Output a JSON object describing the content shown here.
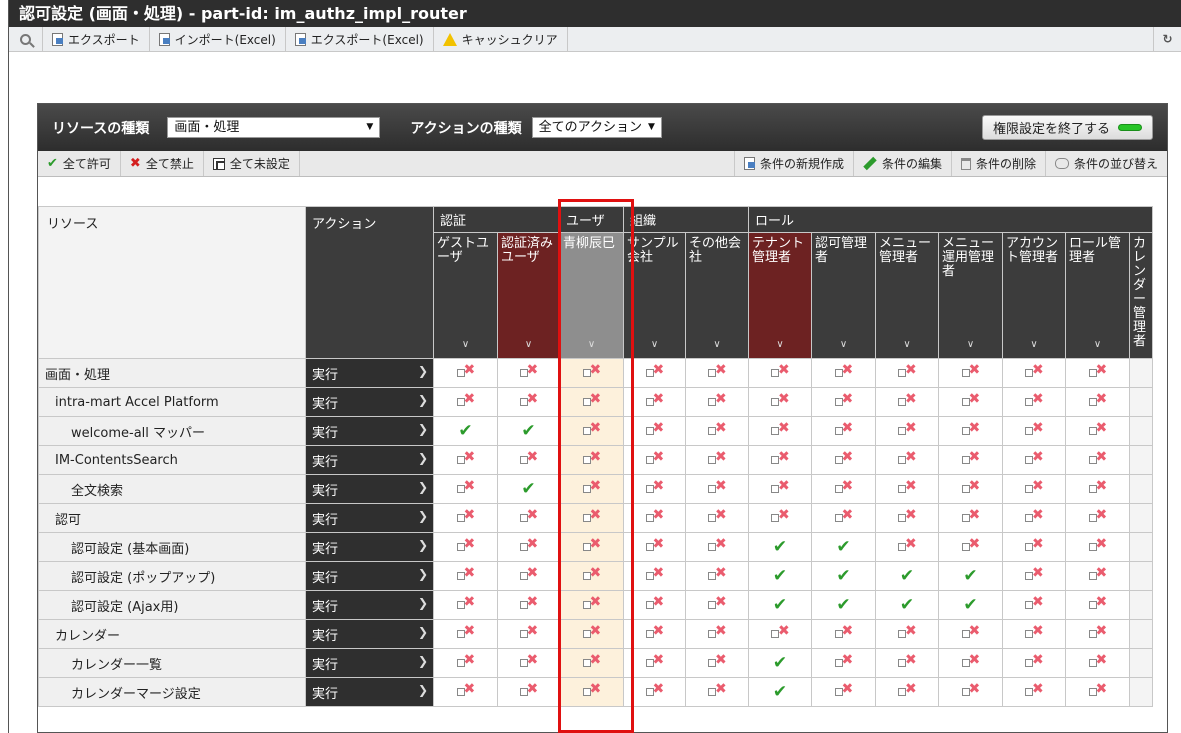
{
  "window": {
    "title": "認可設定 (画面・処理) - part-id: im_authz_impl_router"
  },
  "toolbar": {
    "export": "エクスポート",
    "import_excel": "インポート(Excel)",
    "export_excel": "エクスポート(Excel)",
    "cache_clear": "キャッシュクリア"
  },
  "panel": {
    "resource_type_label": "リソースの種類",
    "resource_type_value": "画面・処理",
    "action_type_label": "アクションの種類",
    "action_type_value": "全てのアクション",
    "end_button": "権限設定を終了する"
  },
  "actionbar": {
    "allow_all": "全て許可",
    "deny_all": "全て禁止",
    "unset_all": "全て未設定",
    "new_condition": "条件の新規作成",
    "edit_condition": "条件の編集",
    "delete_condition": "条件の削除",
    "sort_condition": "条件の並び替え"
  },
  "grid": {
    "resource_header": "リソース",
    "action_header": "アクション",
    "groups": [
      "認証",
      "ユーザ",
      "組織",
      "ロール"
    ],
    "columns": [
      "ゲストユーザ",
      "認証済みユーザ",
      "青柳辰巳",
      "サンプル会社",
      "その他会社",
      "テナント管理者",
      "認可管理者",
      "メニュー管理者",
      "メニュー運用管理者",
      "アカウント管理者",
      "ロール管理者",
      "カレンダー管理者"
    ],
    "action_value": "実行",
    "rows": [
      {
        "name": "画面・処理",
        "cells": "DDDDDDDDDDD"
      },
      {
        "name": "intra-mart Accel Platform",
        "cells": "DDDDDDDDDDD"
      },
      {
        "name": "welcome-all マッパー",
        "cells": "AADDDDDDDDD"
      },
      {
        "name": "IM-ContentsSearch",
        "cells": "DDDDDDDDDDD"
      },
      {
        "name": "全文検索",
        "cells": "DADDDDDDDDD"
      },
      {
        "name": "認可",
        "cells": "DDDDDDDDDDD"
      },
      {
        "name": "認可設定 (基本画面)",
        "cells": "DDDDDAADDDD"
      },
      {
        "name": "認可設定 (ポップアップ)",
        "cells": "DDDDDAAAADD"
      },
      {
        "name": "認可設定 (Ajax用)",
        "cells": "DDDDDAAAADD"
      },
      {
        "name": "カレンダー",
        "cells": "DDDDDDDDDDD"
      },
      {
        "name": "カレンダー一覧",
        "cells": "DDDDDADDDDD"
      },
      {
        "name": "カレンダーマージ設定",
        "cells": "DDDDDADDDDD"
      }
    ]
  }
}
